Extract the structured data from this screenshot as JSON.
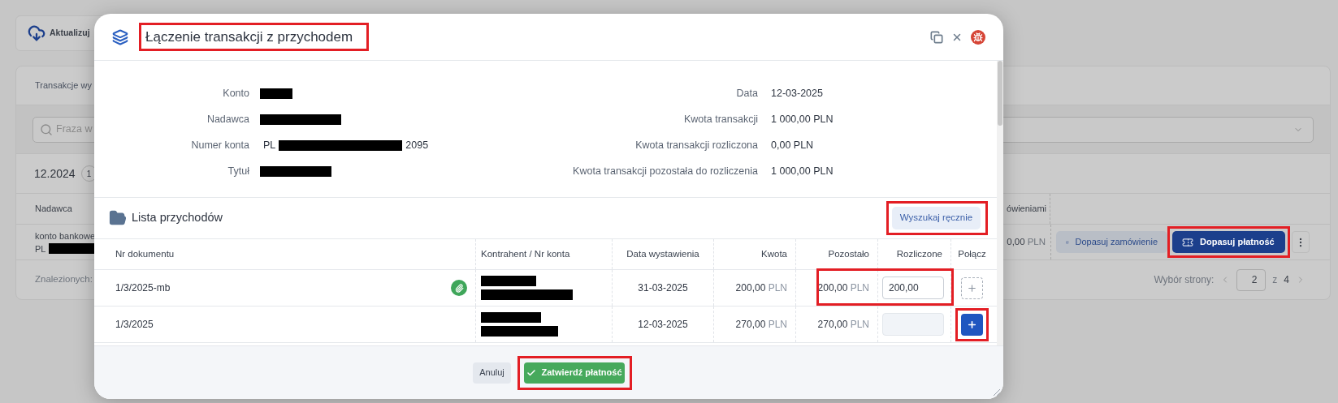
{
  "background": {
    "toolbar_button": "Aktualizuj",
    "card_title": "Transakcje wy",
    "search": {
      "placeholder": "Fraza w"
    },
    "group": {
      "period": "12.2024",
      "badge": "1"
    },
    "table": {
      "column_1": "Nadawca",
      "column_2": "ówieniami",
      "row": {
        "sender": "konto bankowe",
        "account_prefix": "PL",
        "amount": {
          "value": "0,00",
          "currency": "PLN"
        },
        "buttons": [
          {
            "kind": "secondary",
            "label": "Dopasuj zamówienie",
            "highlighted": false
          },
          {
            "kind": "primary",
            "label": "Dopasuj płatność",
            "highlighted": true
          }
        ]
      }
    },
    "footer": {
      "found": "Znalezionych:",
      "page_label": "Wybór strony:",
      "page": "2",
      "of": "z",
      "total": "4"
    }
  },
  "modal": {
    "title": {
      "text": "Łączenie transakcji z przychodem",
      "highlighted": true
    },
    "details_left": [
      {
        "label": "Konto",
        "value": [
          {
            "kind": "redacted"
          }
        ]
      },
      {
        "label": "Nadawca",
        "value": [
          {
            "kind": "redacted"
          }
        ]
      },
      {
        "label": "Numer konta",
        "value": [
          {
            "kind": "text",
            "text": "PL"
          },
          {
            "kind": "redacted"
          },
          {
            "kind": "text",
            "text": "2095"
          }
        ]
      },
      {
        "label": "Tytuł",
        "value": [
          {
            "kind": "redacted"
          }
        ]
      }
    ],
    "details_right": [
      {
        "label": "Data",
        "value": "12-03-2025"
      },
      {
        "label": "Kwota transakcji",
        "value": "1 000,00 PLN"
      },
      {
        "label": "Kwota transakcji rozliczona",
        "value": "0,00 PLN"
      },
      {
        "label": "Kwota transakcji pozostała do rozliczenia",
        "value": "1 000,00 PLN"
      }
    ],
    "list": {
      "title": "Lista przychodów",
      "search_button": {
        "label": "Wyszukaj ręcznie",
        "highlighted": true
      },
      "columns": [
        "Nr dokumentu",
        "Kontrahent / Nr konta",
        "Data wystawienia",
        "Kwota",
        "Pozostało",
        "Rozliczone",
        "Połącz"
      ],
      "rows": [
        {
          "document": "1/3/2025-mb",
          "attachment": true,
          "date": "31-03-2025",
          "amount": {
            "value": "200,00",
            "currency": "PLN"
          },
          "remaining": {
            "value": "200,00",
            "currency": "PLN"
          },
          "settled": {
            "value": "200,00",
            "disabled": false
          },
          "highlighted": true,
          "connect": {
            "active": false,
            "highlighted": false
          }
        },
        {
          "document": "1/3/2025",
          "attachment": false,
          "date": "12-03-2025",
          "amount": {
            "value": "270,00",
            "currency": "PLN"
          },
          "remaining": {
            "value": "270,00",
            "currency": "PLN"
          },
          "settled": {
            "disabled": true
          },
          "highlighted": false,
          "connect": {
            "active": true,
            "highlighted": true
          }
        }
      ]
    },
    "cancel_button": "Anuluj",
    "confirm_button": {
      "label": "Zatwierdź płatność",
      "highlighted": true
    }
  }
}
